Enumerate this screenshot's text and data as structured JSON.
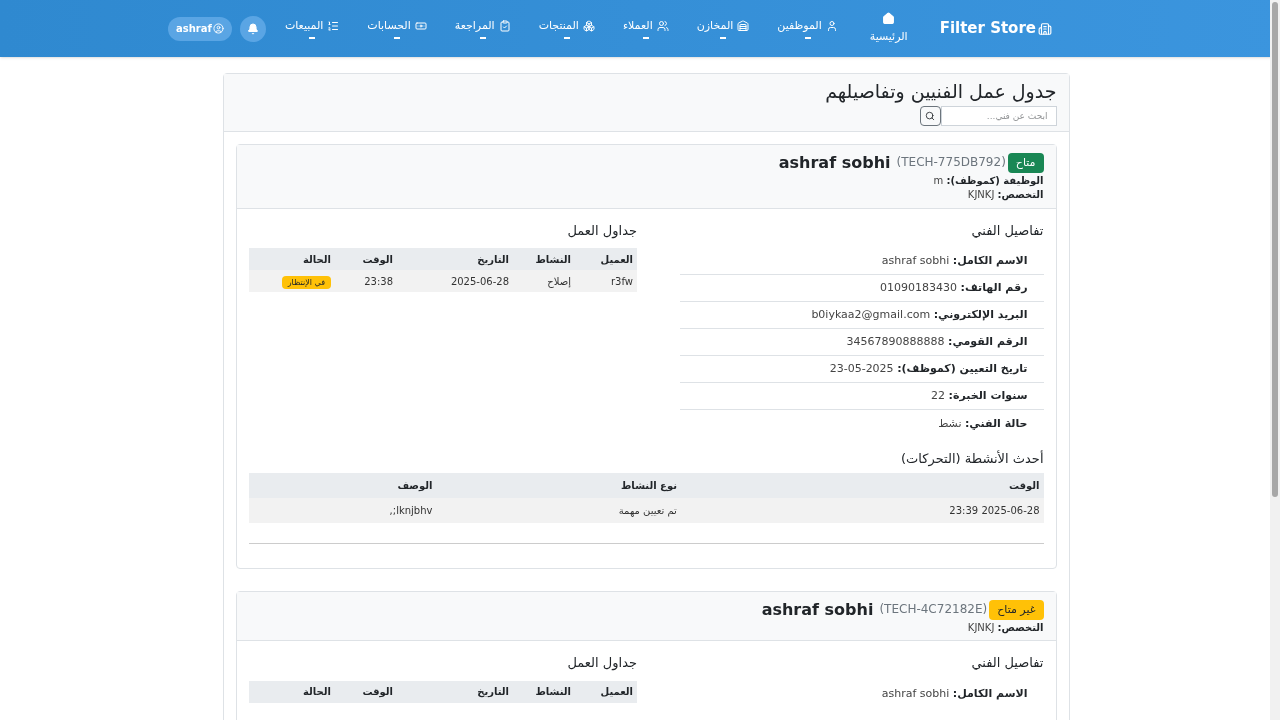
{
  "navbar": {
    "brand": "Filter Store",
    "items": [
      {
        "label": "الرئيسية",
        "kind": "link"
      },
      {
        "label": "الموظفين",
        "kind": "dropdown"
      },
      {
        "label": "المخازن",
        "kind": "dropdown"
      },
      {
        "label": "العملاء",
        "kind": "dropdown"
      },
      {
        "label": "المنتجات",
        "kind": "dropdown"
      },
      {
        "label": "المراجعة",
        "kind": "dropdown"
      },
      {
        "label": "الحسابات",
        "kind": "dropdown"
      },
      {
        "label": "المبيعات",
        "kind": "dropdown"
      }
    ],
    "user": "ashraf"
  },
  "page": {
    "title": "جدول عمل الفنيين وتفاصيلهم",
    "search": {
      "placeholder": "ابحث عن فني..."
    }
  },
  "technicians": [
    {
      "status": {
        "label": "متاح",
        "kind": "available"
      },
      "name": "ashraf sobhi",
      "code": "(TECH-775DB792)",
      "info": [
        {
          "label": "الوظيفة (كموظف):",
          "value": "m"
        },
        {
          "label": "التخصص:",
          "value": "KJNKJ"
        }
      ],
      "details": {
        "title": "تفاصيل الفني",
        "rows": [
          {
            "label": "الاسم الكامل:",
            "value": "ashraf sobhi"
          },
          {
            "label": "رقم الهاتف:",
            "value": "01090183430"
          },
          {
            "label": "البريد الإلكتروني:",
            "value": "b0iykaa2@gmail.com"
          },
          {
            "label": "الرقم القومي:",
            "value": "34567890888888"
          },
          {
            "label": "تاريخ التعيين (كموظف):",
            "value": "2025-05-23"
          },
          {
            "label": "سنوات الخبرة:",
            "value": "22"
          },
          {
            "label": "حالة الفني:",
            "value": "نشط"
          }
        ]
      },
      "schedule": {
        "title": "جداول العمل",
        "columns": [
          "العميل",
          "النشاط",
          "التاريخ",
          "الوقت",
          "الحالة"
        ],
        "rows": [
          {
            "cells": [
              "r3fw",
              "إصلاح",
              "2025-06-28",
              "23:38"
            ],
            "status": {
              "label": "في الإنتظار",
              "kind": "pending"
            }
          }
        ]
      },
      "activities": {
        "title": "أحدث الأنشطة (التحركات)",
        "columns": [
          "الوقت",
          "نوع النشاط",
          "الوصف"
        ],
        "rows": [
          [
            "2025-06-28 23:39",
            "تم تعيين مهمة",
            "lknjbhv;,"
          ]
        ]
      }
    },
    {
      "status": {
        "label": "غير متاح",
        "kind": "unavailable"
      },
      "name": "ashraf sobhi",
      "code": "(TECH-4C72182E)",
      "info": [
        {
          "label": "التخصص:",
          "value": "KJNKJ"
        }
      ],
      "details": {
        "title": "تفاصيل الفني",
        "rows": [
          {
            "label": "الاسم الكامل:",
            "value": "ashraf sobhi"
          }
        ]
      },
      "schedule": {
        "title": "جداول العمل",
        "columns": [
          "العميل",
          "النشاط",
          "التاريخ",
          "الوقت",
          "الحالة"
        ]
      }
    }
  ]
}
